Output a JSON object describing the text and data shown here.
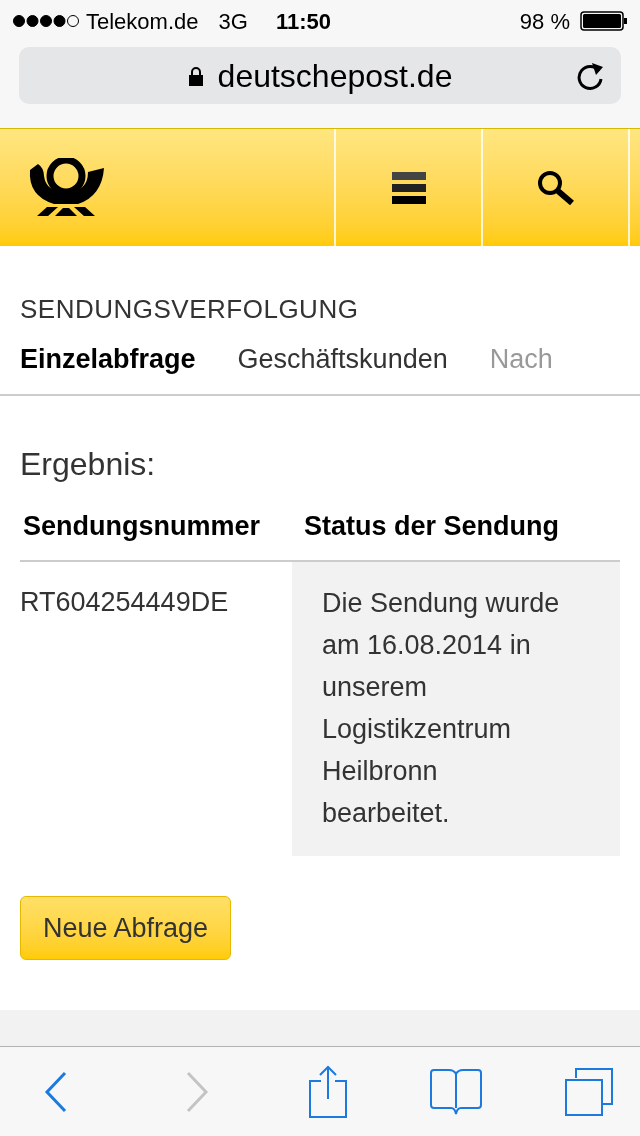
{
  "status_bar": {
    "carrier": "Telekom.de",
    "network": "3G",
    "time": "11:50",
    "battery": "98 %"
  },
  "address_bar": {
    "url": "deutschepost.de"
  },
  "section": {
    "title": "SENDUNGSVERFOLGUNG"
  },
  "tabs": [
    {
      "label": "Einzelabfrage",
      "selected": true
    },
    {
      "label": "Geschäftskunden",
      "selected": false
    },
    {
      "label": "Nach",
      "selected": false
    }
  ],
  "result": {
    "heading": "Ergebnis:",
    "columns": [
      "Sendungsnummer",
      "Status der Sendung"
    ],
    "rows": [
      {
        "number": "RT604254449DE",
        "status": "Die Sendung wurde am 16.08.2014 in unserem Logistikzentrum Heilbronn bearbeitet."
      }
    ]
  },
  "new_query_button": "Neue Abfrage",
  "toolbar": {
    "back": {
      "disabled": false
    },
    "forward": {
      "disabled": true
    }
  }
}
